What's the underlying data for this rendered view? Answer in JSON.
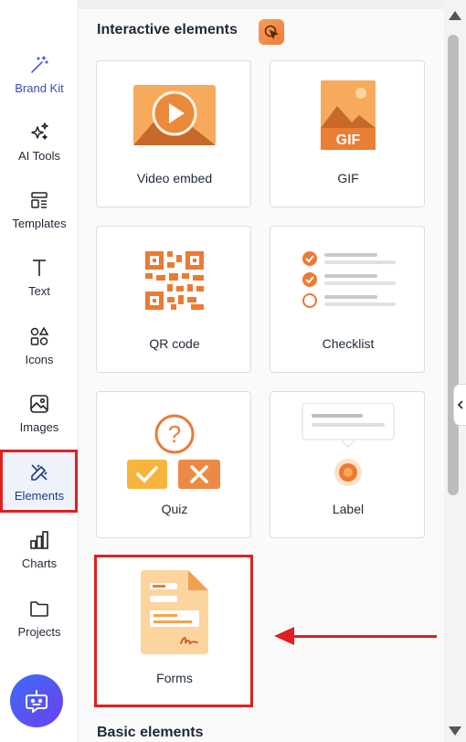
{
  "sidebar": {
    "items": [
      {
        "label": "Brand Kit",
        "icon": "magic-wand-icon"
      },
      {
        "label": "AI Tools",
        "icon": "sparkles-icon"
      },
      {
        "label": "Templates",
        "icon": "templates-icon"
      },
      {
        "label": "Text",
        "icon": "text-icon"
      },
      {
        "label": "Icons",
        "icon": "shapes-icon"
      },
      {
        "label": "Images",
        "icon": "image-icon"
      },
      {
        "label": "Elements",
        "icon": "elements-icon",
        "active": true
      },
      {
        "label": "Charts",
        "icon": "bar-chart-icon"
      },
      {
        "label": "Projects",
        "icon": "folder-icon"
      }
    ],
    "assistant_icon": "robot-chat-icon"
  },
  "panel": {
    "section_interactive": "Interactive elements",
    "section_basic": "Basic elements",
    "cards": [
      {
        "label": "Video embed",
        "icon": "video-play-icon"
      },
      {
        "label": "GIF",
        "icon": "gif-icon",
        "badge": "GIF"
      },
      {
        "label": "QR code",
        "icon": "qr-code-icon"
      },
      {
        "label": "Checklist",
        "icon": "checklist-icon"
      },
      {
        "label": "Quiz",
        "icon": "quiz-icon",
        "glyph": "?"
      },
      {
        "label": "Label",
        "icon": "label-icon"
      },
      {
        "label": "Forms",
        "icon": "form-document-icon"
      }
    ]
  },
  "colors": {
    "accent_orange": "#f28a3c",
    "highlight_red": "#e0201f",
    "active_blue": "#1e3a8a"
  }
}
